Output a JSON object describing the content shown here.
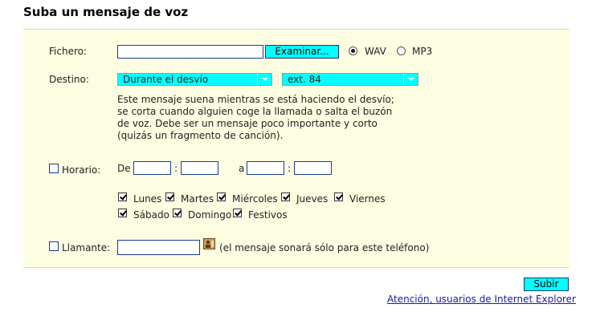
{
  "page": {
    "title": "Suba un mensaje de voz"
  },
  "fichero": {
    "label": "Fichero:",
    "value": "",
    "browse_label": "Examinar...",
    "wav_label": "WAV",
    "mp3_label": "MP3",
    "selected_format": "WAV"
  },
  "destino": {
    "label": "Destino:",
    "select1_value": "Durante el desvío",
    "select2_value": "ext. 84",
    "description": "Este mensaje suena mientras se está haciendo el desvío; se corta cuando alguien coge la llamada o salta el buzón de voz. Debe ser un mensaje poco importante y corto (quizás un fragmento de canción)."
  },
  "horario": {
    "label": "Horario:",
    "checked": false,
    "from_label": "De",
    "to_label": "a",
    "colon": ":",
    "days": [
      {
        "label": "Lunes",
        "checked": true
      },
      {
        "label": "Martes",
        "checked": true
      },
      {
        "label": "Miércoles",
        "checked": true
      },
      {
        "label": "Jueves",
        "checked": true
      },
      {
        "label": "Viernes",
        "checked": true
      },
      {
        "label": "Sábado",
        "checked": true
      },
      {
        "label": "Domingo",
        "checked": true
      },
      {
        "label": "Festivos",
        "checked": true
      }
    ]
  },
  "llamante": {
    "label": "Llamante:",
    "checked": false,
    "value": "",
    "hint": "(el mensaje sonará sólo para este teléfono)"
  },
  "footer": {
    "submit_label": "Subir",
    "ie_link": "Atención, usuarios de Internet Explorer"
  },
  "colors": {
    "accent": "#00ffff",
    "panel_bg": "#fdfde1",
    "link": "#1a1aa6"
  },
  "icons": {
    "contact_picker": "address-book-icon"
  }
}
